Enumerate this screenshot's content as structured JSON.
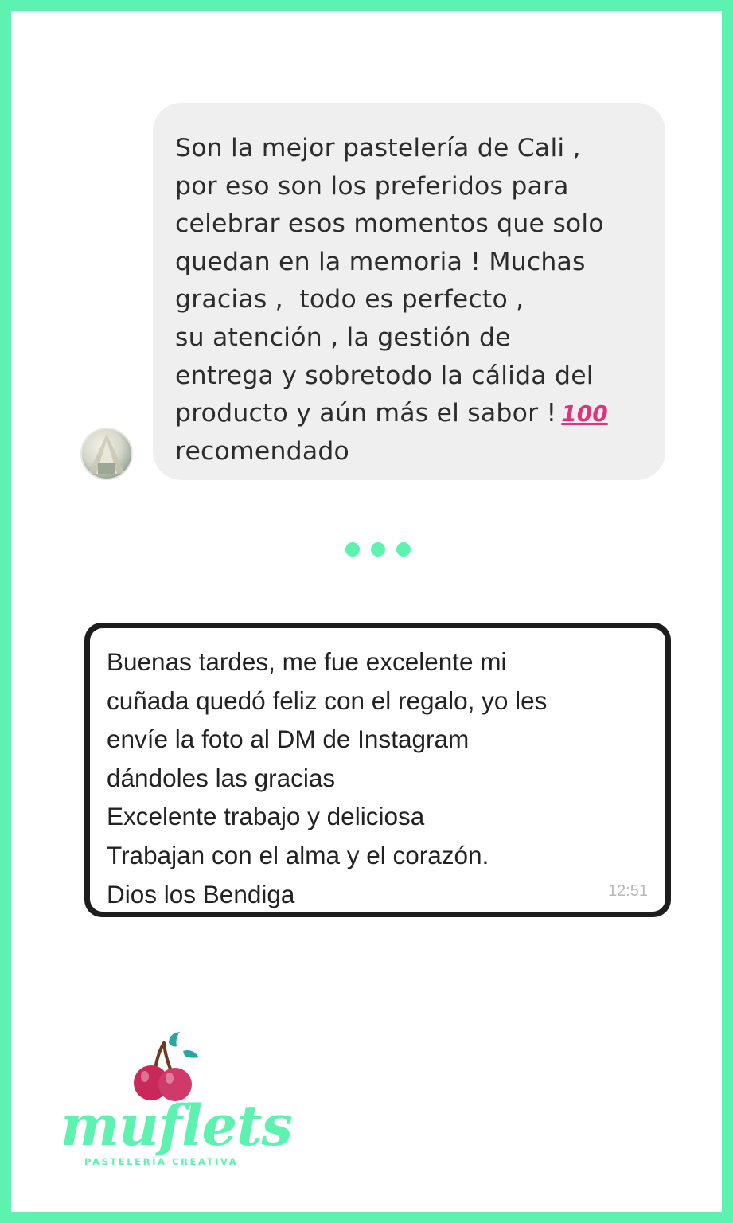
{
  "colors": {
    "frame": "#5ef2b0",
    "top_bubble_bg": "#efefef",
    "bottom_bubble_border": "#1d1d1d",
    "cherry": "#c8285a",
    "leaf": "#26a8a0"
  },
  "top_message": {
    "lines": [
      "Son la mejor pastelería de Cali ,",
      "por eso son los preferidos para",
      "celebrar esos momentos que solo",
      "quedan en la memoria ! Muchas",
      "gracias ,  todo es perfecto ,",
      "su atención , la gestión de",
      "entrega y sobretodo la cálida del",
      "producto y aún más el sabor !",
      "recomendado"
    ],
    "emoji": "100",
    "avatar_icon": "profile-avatar"
  },
  "separator_icon": "ellipsis-dots",
  "bottom_message": {
    "lines": [
      "Buenas tardes, me fue excelente mi",
      "cuñada quedó feliz con el regalo, yo les",
      "envíe la foto al DM de Instagram",
      "dándoles las gracias",
      "Excelente trabajo y deliciosa",
      "Trabajan con el alma y el corazón.",
      "Dios los Bendiga"
    ],
    "time": "12:51"
  },
  "logo": {
    "name": "muflets",
    "tagline": "PASTELERÍA  CREATIVA",
    "icon": "cherries-icon"
  }
}
